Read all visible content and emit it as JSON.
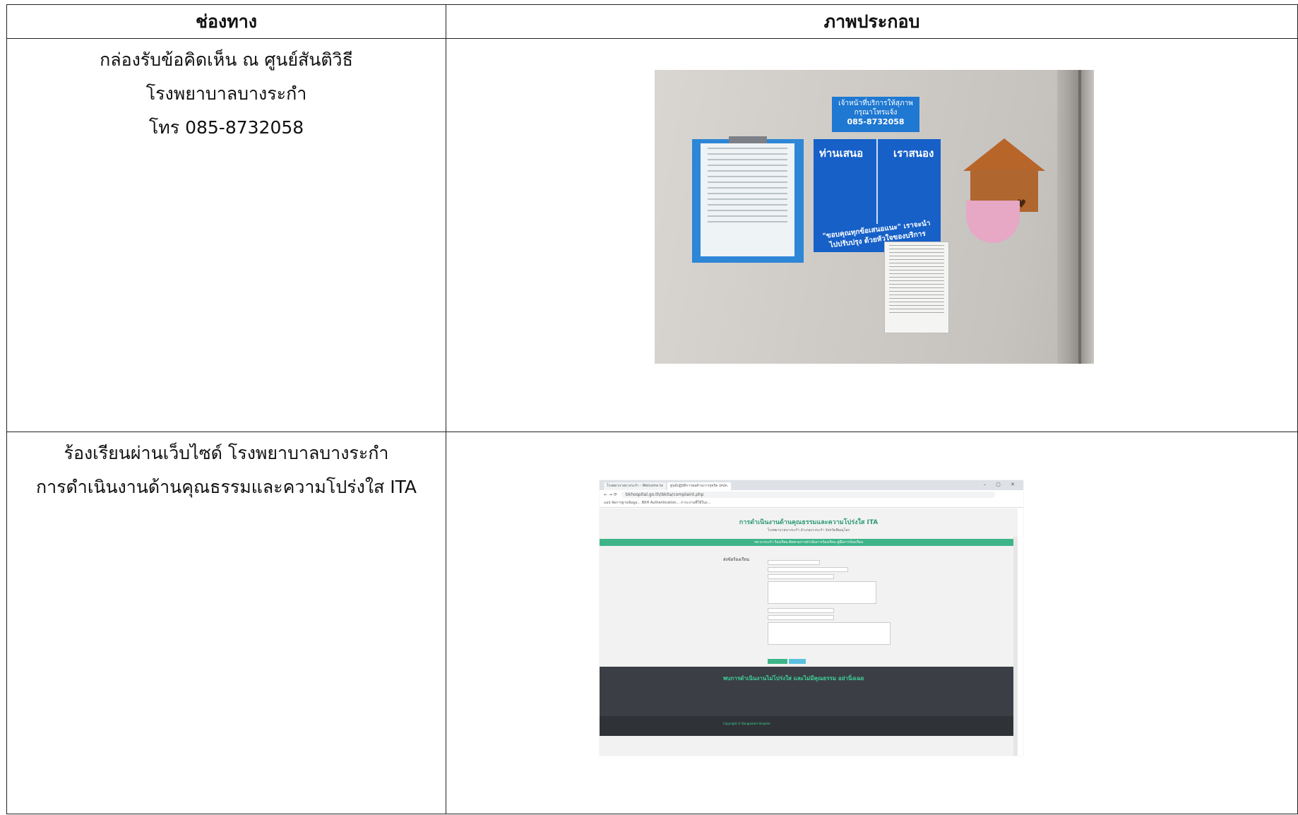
{
  "table": {
    "header_channel": "ช่องทาง",
    "header_illustration": "ภาพประกอบ"
  },
  "rows": [
    {
      "lines": [
        "กล่องรับข้อคิดเห็น ณ ศูนย์สันติวิธี",
        "โรงพยาบาลบางระกำ",
        "โทร 085-8732058"
      ],
      "photo": {
        "sign_title": "เจ้าหน้าที่บริการให้สุภาพ",
        "sign_sub": "กรุณาโทรแจ้ง",
        "sign_phone": "085-8732058",
        "board_left": "ท่านเสนอ",
        "board_right": "เราสนอง",
        "board_bottom": "\"ขอบคุณทุกข้อเสนอแนะ\" เราจะนำไปปรับปรุง ด้วยหัวใจของบริการ"
      }
    },
    {
      "lines": [
        "ร้องเรียนผ่านเว็บไซด์ โรงพยาบาลบางระกำ",
        "การดำเนินงานด้านคุณธรรมและความโปร่งใส ITA"
      ],
      "browser": {
        "tab1": "โรงพยาบาลบางระกำ - Welcome to",
        "tab2": "ศูนย์ปฏิบัติการต่อต้านการทุจริต (ศปท.",
        "url": "bkhospital.go.th/bkita/complaint.php",
        "bookmarks": "แอป   จัดการฐานข้อมูล...   BKH Authentication...   ภาระงานที่ใช้ในง...",
        "page_title": "การดำเนินงานด้านคุณธรรมและความโปร่งใส ITA",
        "page_sub": "โรงพยาบาลบางระกำ อำเภอบางระกำ จังหวัดพิษณุโลก",
        "nav": "รพ.บางระกำ     ร้องเรียน     ติดตามการดำเนินการร้องเรียน     คู่มือการร้องเรียน",
        "form_label": "ส่งข้อร้องเรียน",
        "footer_text": "พบการดำเนินงานไม่โปร่งใส และไม่มีคุณธรรม อย่านิ่งเฉย",
        "copyright": "Copyright © Bangrakam Hospital"
      }
    }
  ]
}
